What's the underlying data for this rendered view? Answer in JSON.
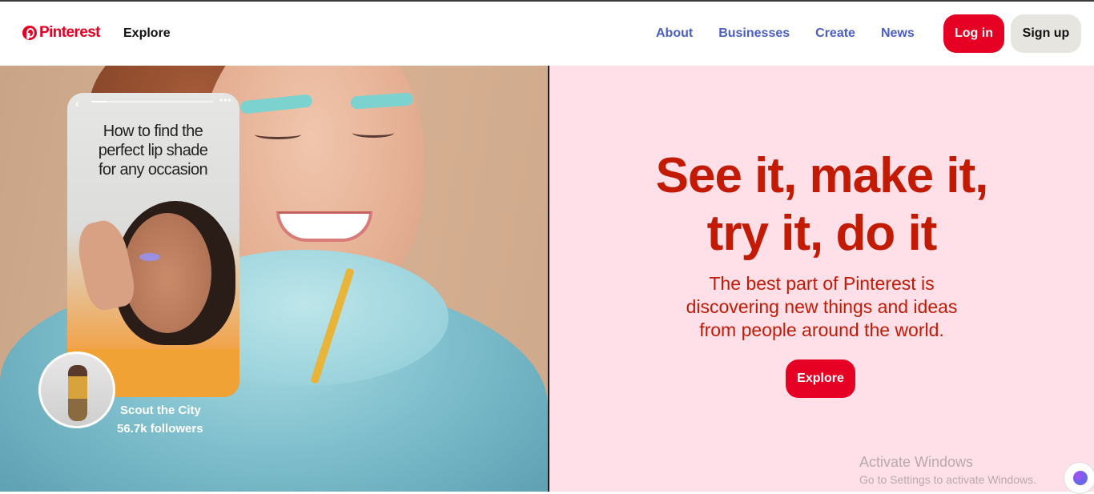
{
  "header": {
    "logo_text": "Pinterest",
    "explore_label": "Explore",
    "nav": [
      "About",
      "Businesses",
      "Create",
      "News"
    ],
    "login_label": "Log in",
    "signup_label": "Sign up"
  },
  "hero": {
    "headline_line1": "See it, make it,",
    "headline_line2": "try it, do it",
    "subtext_line1": "The best part of Pinterest is",
    "subtext_line2": "discovering new things and ideas",
    "subtext_line3": "from people around the world.",
    "explore_button": "Explore"
  },
  "story_card": {
    "title_line1": "How to find the",
    "title_line2": "perfect lip shade",
    "title_line3": "for any occasion",
    "creator_name": "Scout the City",
    "followers": "56.7k followers",
    "progress_fraction": 0.13
  },
  "watermark": {
    "line1": "Activate Windows",
    "line2": "Go to Settings to activate Windows."
  },
  "colors": {
    "brand_red": "#e60023",
    "headline_red": "#c31a04",
    "nav_blue": "#4a5ec6",
    "right_panel_bg": "#ffdfe8"
  }
}
